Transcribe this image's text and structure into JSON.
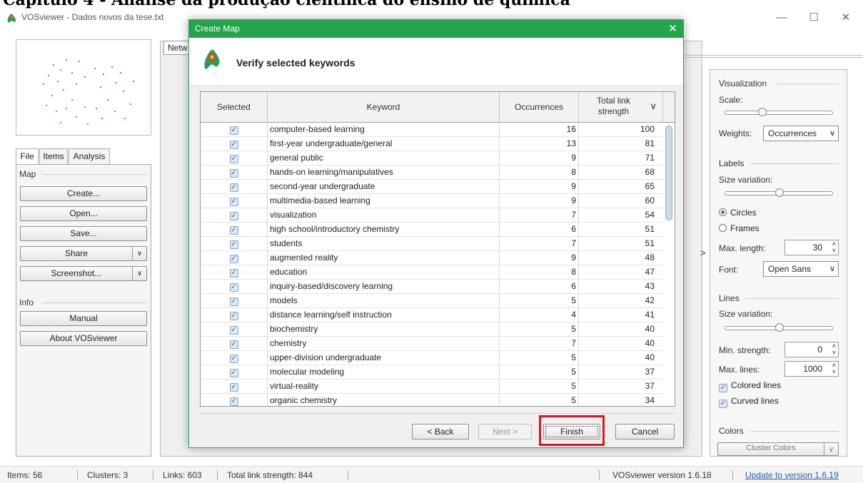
{
  "doc_heading": "Capítulo 4 - Análise da produção científica do ensino de química",
  "window": {
    "title": "VOSviewer - Dados novos da tese.txt",
    "controls": {
      "minimize": "—",
      "maximize": "☐",
      "close": "✕"
    }
  },
  "left_panel": {
    "tabs": [
      "File",
      "Items",
      "Analysis"
    ],
    "map_group": "Map",
    "buttons": {
      "create": "Create...",
      "open": "Open...",
      "save": "Save...",
      "share": "Share",
      "screenshot": "Screenshot..."
    },
    "info_group": "Info",
    "info_buttons": {
      "manual": "Manual",
      "about": "About VOSviewer"
    }
  },
  "network_tab": "Netw",
  "right_panel": {
    "visualization": "Visualization",
    "scale": "Scale:",
    "weights_label": "Weights:",
    "weights_value": "Occurrences",
    "labels": "Labels",
    "size_variation": "Size variation:",
    "circles": "Circles",
    "frames": "Frames",
    "max_length_label": "Max. length:",
    "max_length_value": "30",
    "font_label": "Font:",
    "font_value": "Open Sans",
    "lines": "Lines",
    "lines_size_variation": "Size variation:",
    "min_strength_label": "Min. strength:",
    "min_strength_value": "0",
    "max_lines_label": "Max. lines:",
    "max_lines_value": "1000",
    "colored_lines": "Colored lines",
    "curved_lines": "Curved lines",
    "colors": "Colors",
    "cluster_colors": "Cluster Colors"
  },
  "expand_arrow": ">",
  "status_bar": {
    "items": "Items: 56",
    "clusters": "Clusters: 3",
    "links": "Links: 603",
    "total_link_strength": "Total link strength: 844",
    "version": "VOSviewer version 1.6.18",
    "update": "Update to version 1.6.19"
  },
  "dialog": {
    "title": "Create Map",
    "close": "✕",
    "heading": "Verify selected keywords",
    "columns": {
      "selected": "Selected",
      "keyword": "Keyword",
      "occurrences": "Occurrences",
      "total_link_strength": "Total link strength"
    },
    "rows": [
      {
        "keyword": "computer-based learning",
        "occurrences": "16",
        "strength": "100"
      },
      {
        "keyword": "first-year undergraduate/general",
        "occurrences": "13",
        "strength": "81"
      },
      {
        "keyword": "general public",
        "occurrences": "9",
        "strength": "71"
      },
      {
        "keyword": "hands-on learning/manipulatives",
        "occurrences": "8",
        "strength": "68"
      },
      {
        "keyword": "second-year undergraduate",
        "occurrences": "9",
        "strength": "65"
      },
      {
        "keyword": "multimedia-based learning",
        "occurrences": "9",
        "strength": "60"
      },
      {
        "keyword": "visualization",
        "occurrences": "7",
        "strength": "54"
      },
      {
        "keyword": "high school/introductory chemistry",
        "occurrences": "6",
        "strength": "51"
      },
      {
        "keyword": "students",
        "occurrences": "7",
        "strength": "51"
      },
      {
        "keyword": "augmented reality",
        "occurrences": "9",
        "strength": "48"
      },
      {
        "keyword": "education",
        "occurrences": "8",
        "strength": "47"
      },
      {
        "keyword": "inquiry-based/discovery learning",
        "occurrences": "6",
        "strength": "43"
      },
      {
        "keyword": "models",
        "occurrences": "5",
        "strength": "42"
      },
      {
        "keyword": "distance learning/self instruction",
        "occurrences": "4",
        "strength": "41"
      },
      {
        "keyword": "biochemistry",
        "occurrences": "5",
        "strength": "40"
      },
      {
        "keyword": "chemistry",
        "occurrences": "7",
        "strength": "40"
      },
      {
        "keyword": "upper-division undergraduate",
        "occurrences": "5",
        "strength": "40"
      },
      {
        "keyword": "molecular modeling",
        "occurrences": "5",
        "strength": "37"
      },
      {
        "keyword": "virtual-reality",
        "occurrences": "5",
        "strength": "37"
      },
      {
        "keyword": "organic chemistry",
        "occurrences": "5",
        "strength": "34"
      }
    ],
    "buttons": {
      "back": "< Back",
      "next": "Next >",
      "finish": "Finish",
      "cancel": "Cancel"
    }
  },
  "colors": {
    "dialog_green": "#24a44c",
    "highlight_red": "#e0141e",
    "link_blue": "#1a5fb4"
  },
  "icons": [
    "vosviewer-logo-icon",
    "chevron-down-icon",
    "sort-desc-icon",
    "checkbox-checked-icon",
    "radio-icon",
    "spin-arrows-icon"
  ]
}
